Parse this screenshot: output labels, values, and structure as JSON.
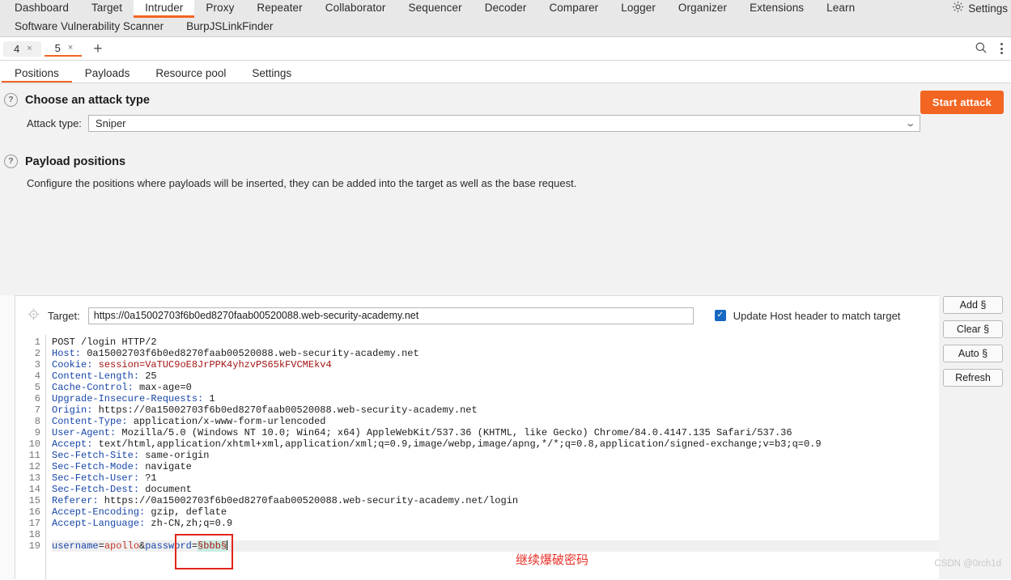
{
  "app": {
    "main_tabs": [
      {
        "label": "Dashboard",
        "active": false
      },
      {
        "label": "Target",
        "active": false
      },
      {
        "label": "Intruder",
        "active": true
      },
      {
        "label": "Proxy",
        "active": false
      },
      {
        "label": "Repeater",
        "active": false
      },
      {
        "label": "Collaborator",
        "active": false
      },
      {
        "label": "Sequencer",
        "active": false
      },
      {
        "label": "Decoder",
        "active": false
      },
      {
        "label": "Comparer",
        "active": false
      },
      {
        "label": "Logger",
        "active": false
      },
      {
        "label": "Organizer",
        "active": false
      },
      {
        "label": "Extensions",
        "active": false
      },
      {
        "label": "Learn",
        "active": false
      }
    ],
    "extension_tabs": [
      {
        "label": "Software Vulnerability Scanner"
      },
      {
        "label": "BurpJSLinkFinder"
      }
    ],
    "settings_label": "Settings",
    "settings_icon": "gear-icon"
  },
  "attack_tabs": {
    "tabs": [
      {
        "label": "4",
        "close": "×",
        "active": false
      },
      {
        "label": "5",
        "close": "×",
        "active": true
      }
    ],
    "add_label": "+",
    "search_icon": "search-icon",
    "menu_icon": "vertical-dots-icon"
  },
  "sub_tabs": [
    {
      "label": "Positions",
      "active": true
    },
    {
      "label": "Payloads",
      "active": false
    },
    {
      "label": "Resource pool",
      "active": false
    },
    {
      "label": "Settings",
      "active": false
    }
  ],
  "attack_type_section": {
    "help_icon": "?",
    "title": "Choose an attack type",
    "field_label": "Attack type:",
    "value": "Sniper",
    "chevron": "⌄",
    "start_attack_label": "Start attack"
  },
  "payload_positions_section": {
    "help_icon": "?",
    "title": "Payload positions",
    "description": "Configure the positions where payloads will be inserted, they can be added into the target as well as the base request."
  },
  "target": {
    "icon": "crosshair-icon",
    "label": "Target:",
    "value": "https://0a15002703f6b0ed8270faab00520088.web-security-academy.net",
    "checkbox_checked": true,
    "checkbox_glyph": "✓",
    "checkbox_label": "Update Host header to match target"
  },
  "side_buttons": [
    {
      "label": "Add §"
    },
    {
      "label": "Clear §"
    },
    {
      "label": "Auto §"
    },
    {
      "label": "Refresh"
    }
  ],
  "request": {
    "line_numbers": [
      "1",
      "2",
      "3",
      "4",
      "5",
      "6",
      "7",
      "8",
      "9",
      "10",
      "11",
      "12",
      "13",
      "14",
      "15",
      "16",
      "17",
      "18",
      "19"
    ],
    "lines": [
      {
        "n": 1,
        "text": "POST /login HTTP/2"
      },
      {
        "n": 2,
        "header": "Host:",
        "text": " 0a15002703f6b0ed8270faab00520088.web-security-academy.net"
      },
      {
        "n": 3,
        "header": "Cookie:",
        "text": " session=VaTUC9oE8JrPPK4yhzvPS65kFVCMEkv4",
        "cookie": true
      },
      {
        "n": 4,
        "header": "Content-Length:",
        "text": " 25"
      },
      {
        "n": 5,
        "header": "Cache-Control:",
        "text": " max-age=0"
      },
      {
        "n": 6,
        "header": "Upgrade-Insecure-Requests:",
        "text": " 1"
      },
      {
        "n": 7,
        "header": "Origin:",
        "text": " https://0a15002703f6b0ed8270faab00520088.web-security-academy.net"
      },
      {
        "n": 8,
        "header": "Content-Type:",
        "text": " application/x-www-form-urlencoded"
      },
      {
        "n": 9,
        "header": "User-Agent:",
        "text": " Mozilla/5.0 (Windows NT 10.0; Win64; x64) AppleWebKit/537.36 (KHTML, like Gecko) Chrome/84.0.4147.135 Safari/537.36"
      },
      {
        "n": 10,
        "header": "Accept:",
        "text": " text/html,application/xhtml+xml,application/xml;q=0.9,image/webp,image/apng,*/*;q=0.8,application/signed-exchange;v=b3;q=0.9"
      },
      {
        "n": 11,
        "header": "Sec-Fetch-Site:",
        "text": " same-origin"
      },
      {
        "n": 12,
        "header": "Sec-Fetch-Mode:",
        "text": " navigate"
      },
      {
        "n": 13,
        "header": "Sec-Fetch-User:",
        "text": " ?1"
      },
      {
        "n": 14,
        "header": "Sec-Fetch-Dest:",
        "text": " document"
      },
      {
        "n": 15,
        "header": "Referer:",
        "text": " https://0a15002703f6b0ed8270faab00520088.web-security-academy.net/login"
      },
      {
        "n": 16,
        "header": "Accept-Encoding:",
        "text": " gzip, deflate"
      },
      {
        "n": 17,
        "header": "Accept-Language:",
        "text": " zh-CN,zh;q=0.9"
      },
      {
        "n": 18,
        "text": ""
      }
    ],
    "body": {
      "key1": "username",
      "eq1": "=",
      "value1": "apollo",
      "amp": "&",
      "key2": "password",
      "eq2": "=",
      "payload_marker": "§bbb§"
    }
  },
  "annotation": {
    "text": "继续爆破密码",
    "color": "#e8322a"
  },
  "watermark": "CSDN @0rch1d",
  "colors": {
    "accent": "#f26522",
    "header_blue": "#1746a8",
    "cookie_red": "#a31515",
    "payload_highlight": "#c9ece1",
    "checkbox_blue": "#1668c1"
  }
}
